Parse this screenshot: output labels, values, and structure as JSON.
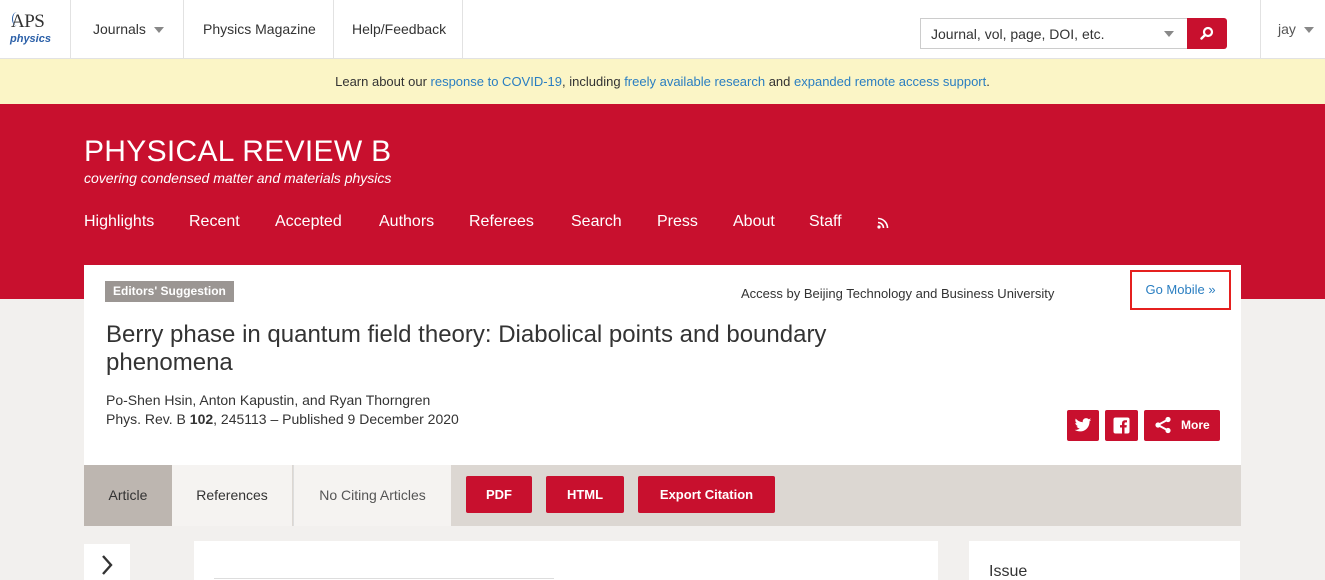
{
  "topbar": {
    "logo_text": "APS",
    "logo_sub": "physics",
    "journals_label": "Journals",
    "magazine_label": "Physics Magazine",
    "help_label": "Help/Feedback",
    "search_placeholder": "Journal, vol, page, DOI, etc.",
    "user_label": "jay"
  },
  "banner": {
    "text_1": "Learn about our ",
    "link_1": "response to COVID-19",
    "text_2": ", including ",
    "link_2": "freely available research",
    "text_3": " and ",
    "link_3": "expanded remote access support",
    "text_4": "."
  },
  "journal": {
    "title": "PHYSICAL REVIEW B",
    "subtitle": "covering condensed matter and materials physics",
    "nav": [
      "Highlights",
      "Recent",
      "Accepted",
      "Authors",
      "Referees",
      "Search",
      "Press",
      "About",
      "Staff"
    ]
  },
  "article": {
    "badge": "Editors' Suggestion",
    "access": "Access by Beijing Technology and Business University",
    "go_mobile": "Go Mobile »",
    "title": "Berry phase in quantum field theory: Diabolical points and boundary phenomena",
    "authors": "Po-Shen Hsin, Anton Kapustin, and Ryan Thorngren",
    "citation_prefix": "Phys. Rev. B ",
    "citation_volume": "102",
    "citation_suffix": ", 245113 – Published 9 December 2020",
    "more_label": "More"
  },
  "tabs": {
    "article": "Article",
    "references": "References",
    "citing": "No Citing Articles",
    "pdf": "PDF",
    "html": "HTML",
    "export": "Export Citation"
  },
  "sidebar": {
    "issue_label": "Issue"
  },
  "colors": {
    "brand_red": "#c8102e",
    "link_blue": "#2a7ec1",
    "banner_yellow": "#fbf5c6",
    "highlight_box": "#e5201f"
  }
}
